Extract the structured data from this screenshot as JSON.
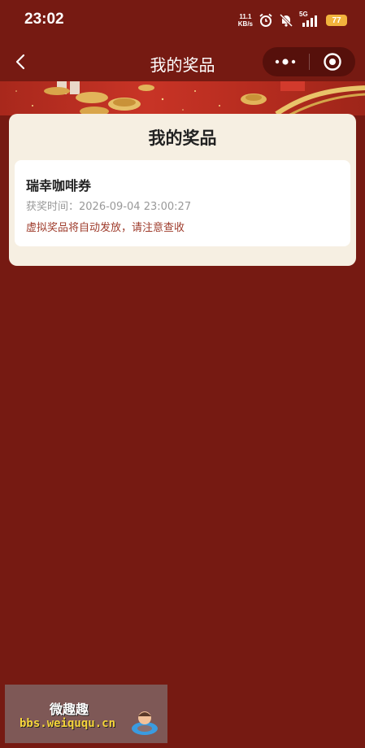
{
  "status_bar": {
    "time": "23:02",
    "net_speed_value": "11.1",
    "net_speed_unit": "KB/s",
    "signal_label": "5G",
    "battery": "77"
  },
  "nav": {
    "title": "我的奖品"
  },
  "card": {
    "title": "我的奖品",
    "prizes": [
      {
        "name": "瑞幸咖啡券",
        "time_label": "获奖时间：",
        "time_value": "2026-09-04 23:00:27",
        "note": "虚拟奖品将自动发放，请注意查收"
      }
    ]
  },
  "watermark": {
    "title": "微趣趣",
    "url": "bbs.weiququ.cn"
  },
  "colors": {
    "background": "#761a12",
    "card": "#f6efe2",
    "note": "#9e3b2b",
    "battery": "#f2b33d"
  }
}
